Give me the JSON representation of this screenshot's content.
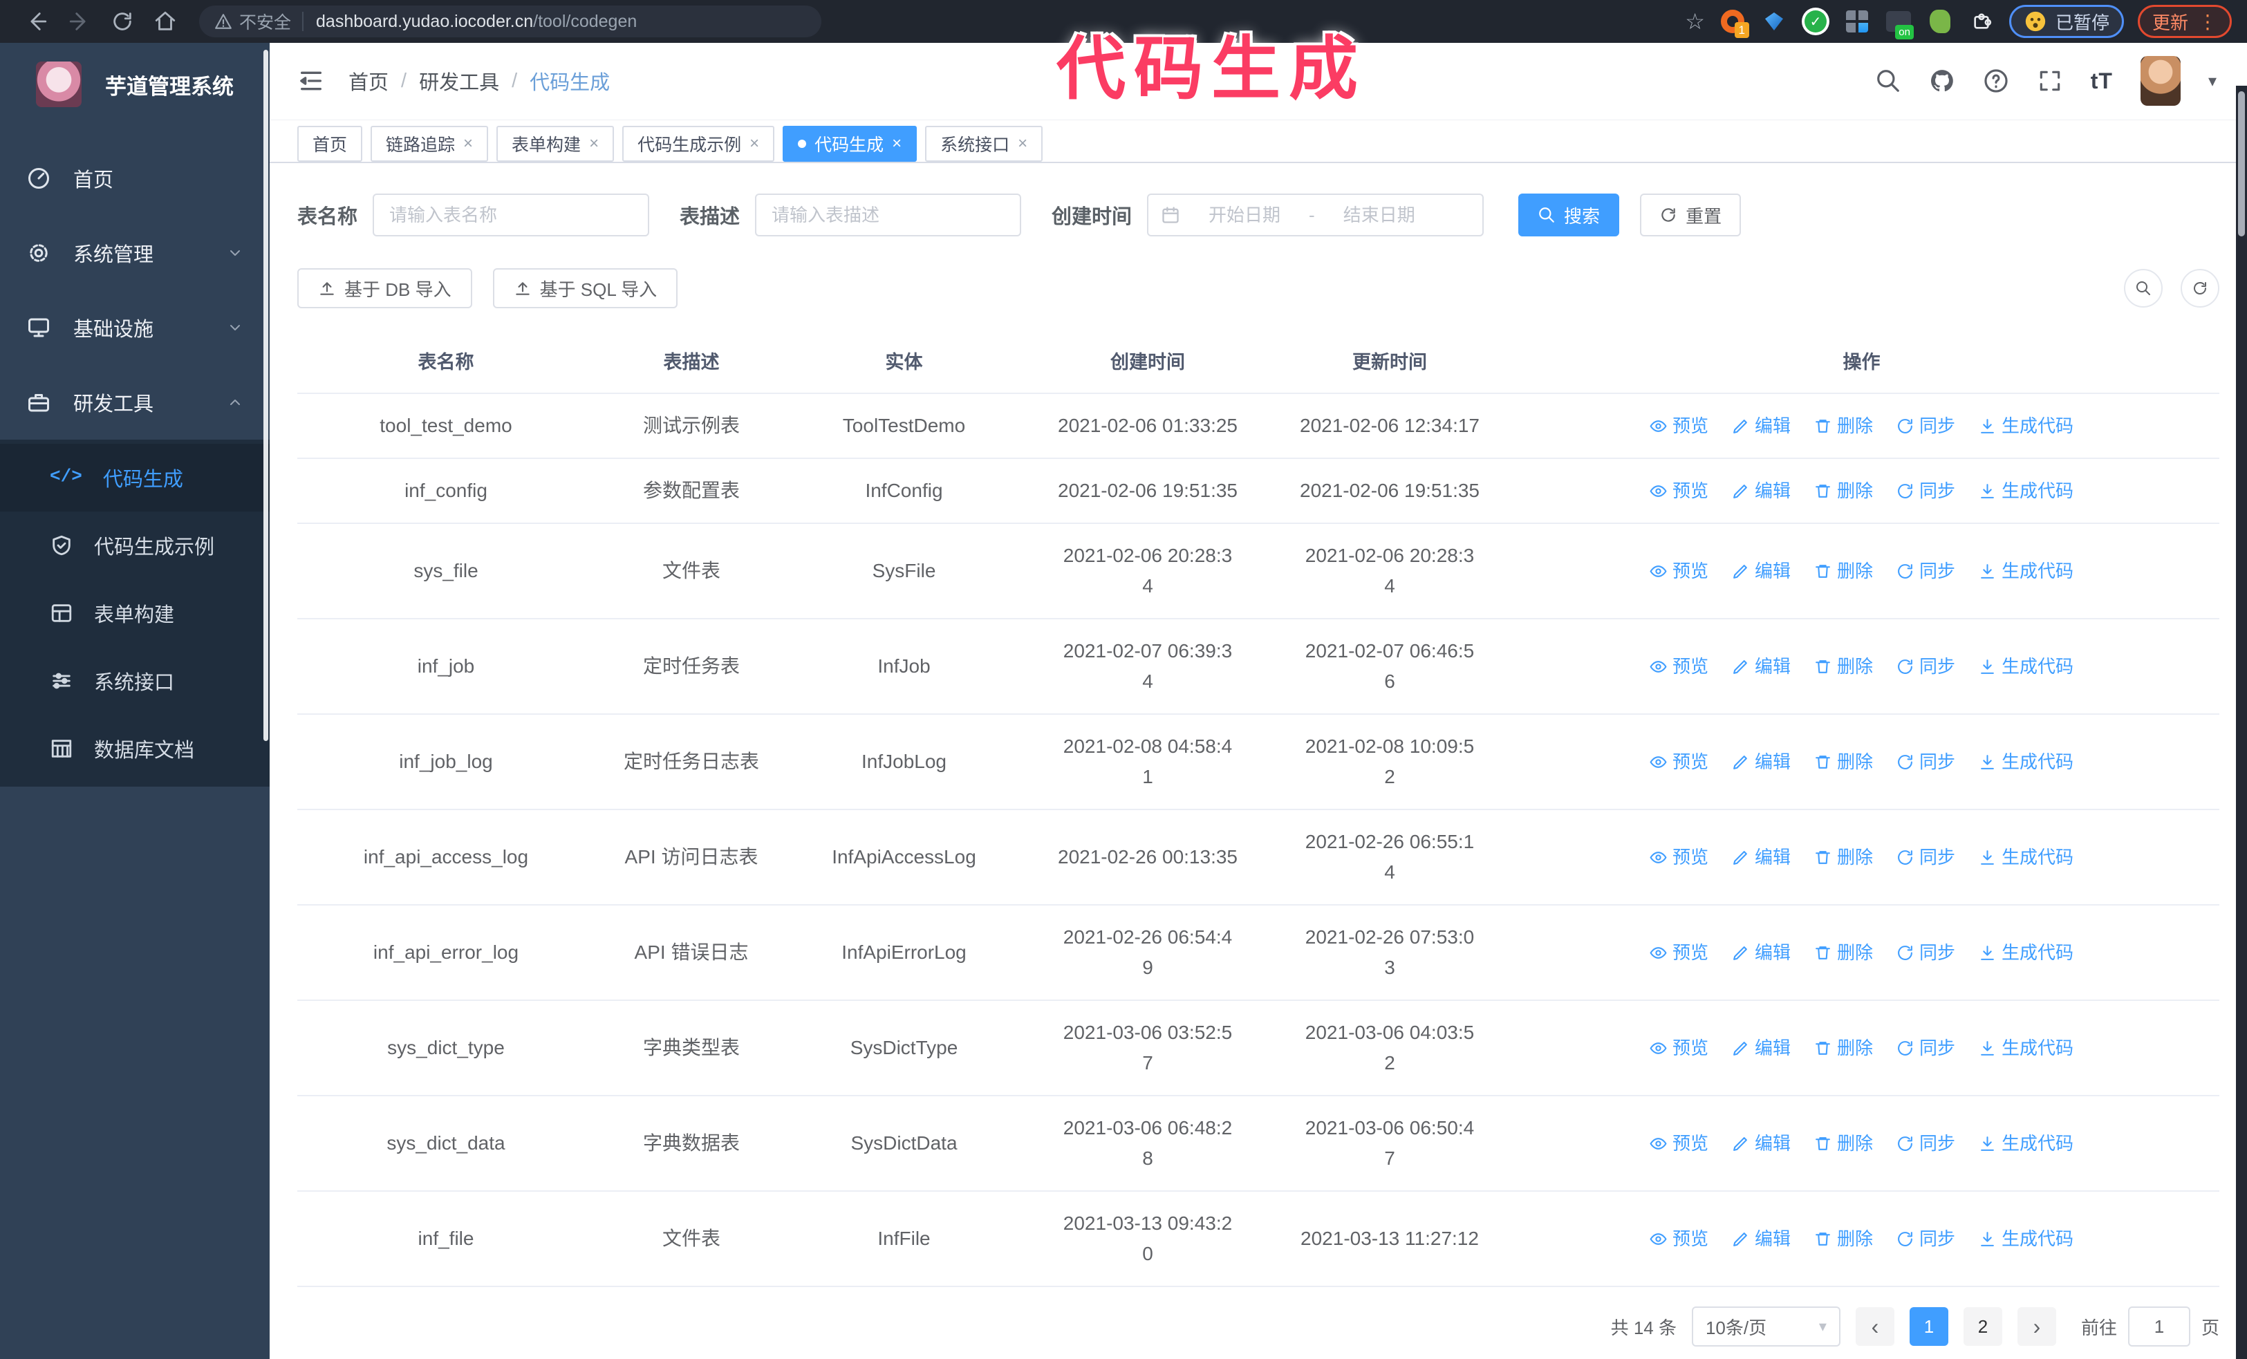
{
  "colors": {
    "accent": "#409eff",
    "annotation_pink": "#fb3c63",
    "sidebar_bg": "#304156",
    "submenu_bg": "#1f2d3d",
    "tab_active_bg": "#409eff",
    "chrome_bg": "#21262f"
  },
  "browser": {
    "security_label": "不安全",
    "url_host": "dashboard.yudao.iocoder.cn",
    "url_path": "/tool/codegen",
    "ext_badge": "1",
    "ext_on_badge": "on",
    "paused_label": "已暂停",
    "update_label": "更新"
  },
  "annotation": {
    "text": "代码生成"
  },
  "sidebar": {
    "title": "芋道管理系统",
    "items": [
      {
        "label": "首页"
      },
      {
        "label": "系统管理"
      },
      {
        "label": "基础设施"
      },
      {
        "label": "研发工具"
      }
    ],
    "submenu": [
      {
        "label": "代码生成"
      },
      {
        "label": "代码生成示例"
      },
      {
        "label": "表单构建"
      },
      {
        "label": "系统接口"
      },
      {
        "label": "数据库文档"
      }
    ]
  },
  "header": {
    "breadcrumb": [
      "首页",
      "研发工具",
      "代码生成"
    ],
    "breadcrumb_separator": "/",
    "font_size_label": "tT"
  },
  "tabs": [
    {
      "label": "首页"
    },
    {
      "label": "链路追踪"
    },
    {
      "label": "表单构建"
    },
    {
      "label": "代码生成示例"
    },
    {
      "label": "代码生成"
    },
    {
      "label": "系统接口"
    }
  ],
  "filters": {
    "name_label": "表名称",
    "name_placeholder": "请输入表名称",
    "desc_label": "表描述",
    "desc_placeholder": "请输入表描述",
    "time_label": "创建时间",
    "start_placeholder": "开始日期",
    "range_separator": "-",
    "end_placeholder": "结束日期",
    "search_label": "搜索",
    "reset_label": "重置"
  },
  "toolbar": {
    "db_import_label": "基于 DB 导入",
    "sql_import_label": "基于 SQL 导入"
  },
  "table": {
    "columns": [
      "表名称",
      "表描述",
      "实体",
      "创建时间",
      "更新时间",
      "操作"
    ],
    "actions": {
      "preview": "预览",
      "edit": "编辑",
      "delete": "删除",
      "sync": "同步",
      "generate": "生成代码"
    },
    "rows": [
      {
        "name": "tool_test_demo",
        "description": "测试示例表",
        "entity": "ToolTestDemo",
        "create_time": "2021-02-06 01:33:25",
        "update_time": "2021-02-06 12:34:17"
      },
      {
        "name": "inf_config",
        "description": "参数配置表",
        "entity": "InfConfig",
        "create_time": "2021-02-06 19:51:35",
        "update_time": "2021-02-06 19:51:35"
      },
      {
        "name": "sys_file",
        "description": "文件表",
        "entity": "SysFile",
        "create_time": "2021-02-06 20:28:3\n4",
        "update_time": "2021-02-06 20:28:3\n4"
      },
      {
        "name": "inf_job",
        "description": "定时任务表",
        "entity": "InfJob",
        "create_time": "2021-02-07 06:39:3\n4",
        "update_time": "2021-02-07 06:46:5\n6"
      },
      {
        "name": "inf_job_log",
        "description": "定时任务日志表",
        "entity": "InfJobLog",
        "create_time": "2021-02-08 04:58:4\n1",
        "update_time": "2021-02-08 10:09:5\n2"
      },
      {
        "name": "inf_api_access_log",
        "description": "API 访问日志表",
        "entity": "InfApiAccessLog",
        "create_time": "2021-02-26 00:13:35",
        "update_time": "2021-02-26 06:55:1\n4"
      },
      {
        "name": "inf_api_error_log",
        "description": "API 错误日志",
        "entity": "InfApiErrorLog",
        "create_time": "2021-02-26 06:54:4\n9",
        "update_time": "2021-02-26 07:53:0\n3"
      },
      {
        "name": "sys_dict_type",
        "description": "字典类型表",
        "entity": "SysDictType",
        "create_time": "2021-03-06 03:52:5\n7",
        "update_time": "2021-03-06 04:03:5\n2"
      },
      {
        "name": "sys_dict_data",
        "description": "字典数据表",
        "entity": "SysDictData",
        "create_time": "2021-03-06 06:48:2\n8",
        "update_time": "2021-03-06 06:50:4\n7"
      },
      {
        "name": "inf_file",
        "description": "文件表",
        "entity": "InfFile",
        "create_time": "2021-03-13 09:43:2\n0",
        "update_time": "2021-03-13 11:27:12"
      }
    ]
  },
  "pagination": {
    "total": "共 14 条",
    "page_size": "10条/页",
    "pages": [
      "1",
      "2"
    ],
    "goto_label": "前往",
    "goto_value": "1",
    "unit_label": "页"
  },
  "icons": {
    "close": "×",
    "star": "☆",
    "more": "⋮",
    "caret": "▾",
    "prev": "‹",
    "next": "›",
    "code": "</>",
    "check": "✓"
  }
}
